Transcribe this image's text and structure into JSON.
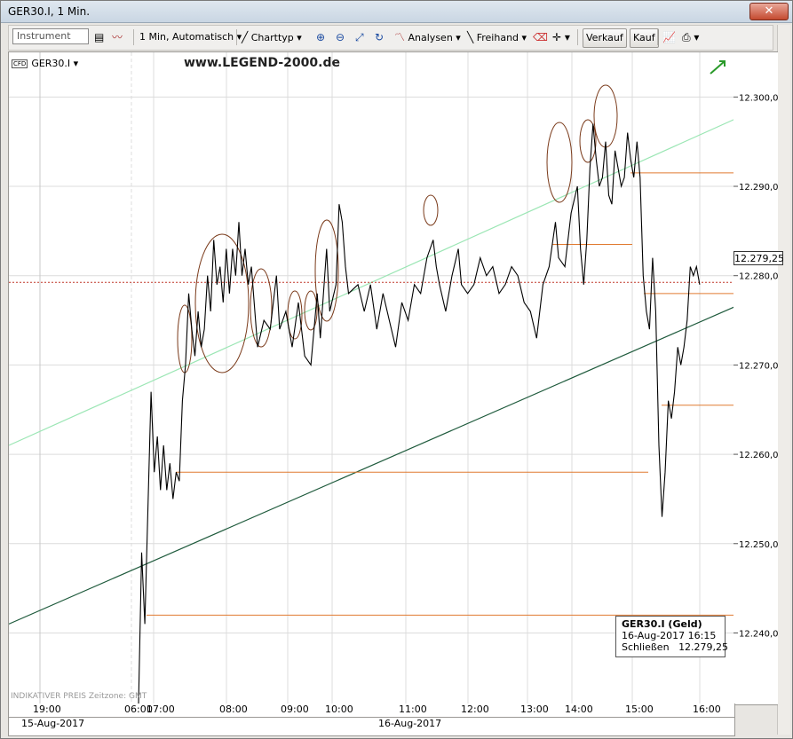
{
  "window": {
    "title": "GER30.I, 1 Min.",
    "close_label": "✕"
  },
  "toolbar": {
    "instrument_placeholder": "Instrument",
    "timeframe_label": "1 Min,  Automatisch",
    "charttype_label": "Charttyp",
    "analysen_label": "Analysen",
    "freihand_label": "Freihand",
    "verkauf_label": "Verkauf",
    "kauf_label": "Kauf"
  },
  "legend": {
    "symbol": "GER30.I",
    "badge": "CFD"
  },
  "watermark": "www.LEGEND-2000.de",
  "infobox": {
    "line1": "GER30.I (Geld)",
    "line2": "16-Aug-2017 16:15",
    "line3_label": "Schließen",
    "line3_value": "12.279,25"
  },
  "footnote": "INDIKATIVER PREIS   Zeitzone: GMT",
  "last_price": "12.279,25",
  "time_axis": {
    "ticks": [
      "19:00",
      "06:01",
      "07:00",
      "08:00",
      "09:00",
      "10:00",
      "11:00",
      "12:00",
      "13:00",
      "14:00",
      "15:00",
      "16:00"
    ],
    "dates": [
      "15-Aug-2017",
      "16-Aug-2017"
    ]
  },
  "chart_data": {
    "type": "line",
    "title": "GER30.I, 1 Min.",
    "xlabel": "",
    "ylabel": "",
    "ylim": [
      12232,
      12305
    ],
    "yticks": [
      "12.240,00",
      "12.250,00",
      "12.260,00",
      "12.270,00",
      "12.280,00",
      "12.290,00",
      "12.300,00"
    ],
    "ytick_values": [
      12240,
      12250,
      12260,
      12270,
      12280,
      12290,
      12300
    ],
    "x_unit": "minutes after 06:01, 16-Aug-2017",
    "series": [
      {
        "points": [
          [
            0,
            12232
          ],
          [
            1,
            12249
          ],
          [
            2,
            12241
          ],
          [
            3,
            12254
          ],
          [
            4,
            12267
          ],
          [
            5,
            12258
          ],
          [
            6,
            12262
          ],
          [
            7,
            12256
          ],
          [
            8,
            12261
          ],
          [
            9,
            12256
          ],
          [
            10,
            12259
          ],
          [
            11,
            12255
          ],
          [
            12,
            12258
          ],
          [
            13,
            12257
          ],
          [
            14,
            12266
          ],
          [
            15,
            12270
          ],
          [
            16,
            12278
          ],
          [
            17,
            12274
          ],
          [
            18,
            12271
          ],
          [
            19,
            12276
          ],
          [
            20,
            12272
          ],
          [
            21,
            12274
          ],
          [
            22,
            12280
          ],
          [
            23,
            12276
          ],
          [
            24,
            12284
          ],
          [
            25,
            12279
          ],
          [
            26,
            12281
          ],
          [
            27,
            12277
          ],
          [
            28,
            12283
          ],
          [
            29,
            12278
          ],
          [
            30,
            12283
          ],
          [
            31,
            12280
          ],
          [
            32,
            12286
          ],
          [
            33,
            12280
          ],
          [
            34,
            12283
          ],
          [
            35,
            12279
          ],
          [
            36,
            12281
          ],
          [
            38,
            12272
          ],
          [
            40,
            12275
          ],
          [
            42,
            12274
          ],
          [
            44,
            12280
          ],
          [
            45,
            12274
          ],
          [
            47,
            12276
          ],
          [
            49,
            12272
          ],
          [
            51,
            12277
          ],
          [
            53,
            12271
          ],
          [
            55,
            12270
          ],
          [
            57,
            12278
          ],
          [
            58,
            12273
          ],
          [
            60,
            12283
          ],
          [
            61,
            12276
          ],
          [
            63,
            12279
          ],
          [
            64,
            12288
          ],
          [
            65,
            12286
          ],
          [
            66,
            12281
          ],
          [
            67,
            12278
          ],
          [
            70,
            12279
          ],
          [
            72,
            12276
          ],
          [
            74,
            12279
          ],
          [
            76,
            12274
          ],
          [
            78,
            12278
          ],
          [
            80,
            12275
          ],
          [
            82,
            12272
          ],
          [
            84,
            12277
          ],
          [
            86,
            12275
          ],
          [
            88,
            12279
          ],
          [
            90,
            12278
          ],
          [
            92,
            12282
          ],
          [
            94,
            12284
          ],
          [
            95,
            12281
          ],
          [
            96,
            12279
          ],
          [
            98,
            12276
          ],
          [
            100,
            12280
          ],
          [
            102,
            12283
          ],
          [
            103,
            12279
          ],
          [
            105,
            12278
          ],
          [
            107,
            12279
          ],
          [
            109,
            12282
          ],
          [
            111,
            12280
          ],
          [
            113,
            12281
          ],
          [
            115,
            12278
          ],
          [
            117,
            12279
          ],
          [
            119,
            12281
          ],
          [
            121,
            12280
          ],
          [
            123,
            12277
          ],
          [
            125,
            12276
          ],
          [
            127,
            12273
          ],
          [
            129,
            12279
          ],
          [
            131,
            12281
          ],
          [
            133,
            12286
          ],
          [
            134,
            12282
          ],
          [
            136,
            12281
          ],
          [
            138,
            12287
          ],
          [
            140,
            12290
          ],
          [
            141,
            12283
          ],
          [
            142,
            12279
          ],
          [
            143,
            12284
          ],
          [
            144,
            12292
          ],
          [
            145,
            12297
          ],
          [
            146,
            12293
          ],
          [
            147,
            12290
          ],
          [
            148,
            12291
          ],
          [
            149,
            12295
          ],
          [
            150,
            12289
          ],
          [
            151,
            12288
          ],
          [
            152,
            12294
          ],
          [
            153,
            12292
          ],
          [
            154,
            12290
          ],
          [
            155,
            12291
          ],
          [
            156,
            12296
          ],
          [
            157,
            12293
          ],
          [
            158,
            12291
          ],
          [
            159,
            12295
          ],
          [
            160,
            12291
          ],
          [
            161,
            12280
          ],
          [
            162,
            12276
          ],
          [
            163,
            12274
          ],
          [
            164,
            12282
          ],
          [
            165,
            12276
          ],
          [
            166,
            12261
          ],
          [
            167,
            12253
          ],
          [
            168,
            12258
          ],
          [
            169,
            12266
          ],
          [
            170,
            12264
          ],
          [
            171,
            12267
          ],
          [
            172,
            12272
          ],
          [
            173,
            12270
          ],
          [
            174,
            12272
          ],
          [
            175,
            12275
          ],
          [
            176,
            12281
          ],
          [
            177,
            12280
          ],
          [
            178,
            12281
          ],
          [
            179,
            12279
          ]
        ]
      }
    ],
    "trendlines": [
      {
        "color": "#9be6b4",
        "from": [
          12261,
          "left"
        ],
        "to": [
          12297.5,
          "right"
        ]
      },
      {
        "color": "#1e5a3c",
        "from": [
          12241,
          "left"
        ],
        "to": [
          12276.5,
          "right"
        ]
      }
    ],
    "horizontal_levels": [
      12291.5,
      12283.5,
      12278,
      12265.5,
      12258,
      12242,
      12279.25
    ],
    "annotation": "ellipses drawn around local highs"
  }
}
